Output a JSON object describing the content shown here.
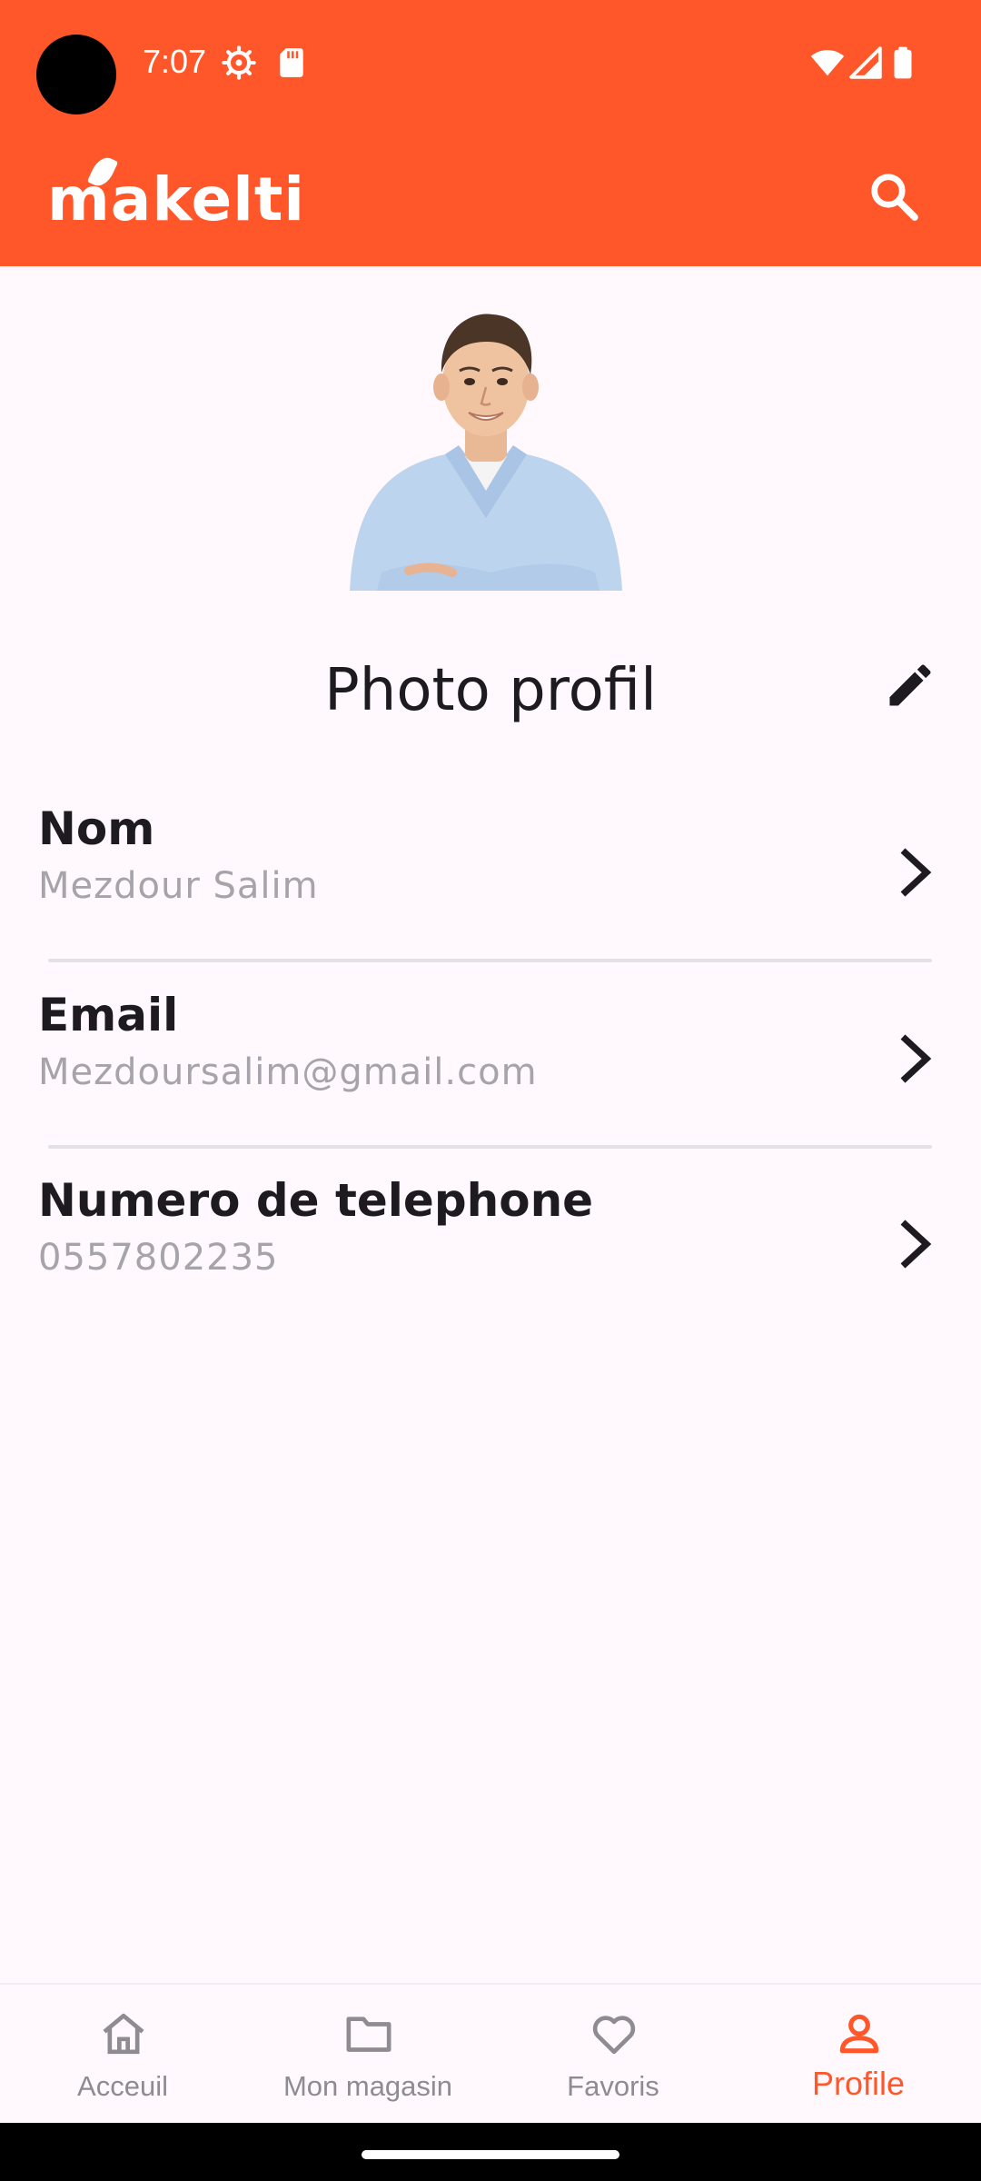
{
  "status_bar": {
    "time": "7:07"
  },
  "app_bar": {
    "logo_text": "akelti",
    "logo_first_letter": "m",
    "brand_color": "#FF572A"
  },
  "profile": {
    "photo_title": "Photo profil",
    "fields": [
      {
        "label": "Nom",
        "value": "Mezdour Salim"
      },
      {
        "label": "Email",
        "value": "Mezdoursalim@gmail.com"
      },
      {
        "label": "Numero de telephone",
        "value": "0557802235"
      }
    ]
  },
  "bottom_nav": {
    "items": [
      {
        "label": "Acceuil",
        "icon": "home-icon",
        "active": false
      },
      {
        "label": "Mon magasin",
        "icon": "folder-icon",
        "active": false
      },
      {
        "label": "Favoris",
        "icon": "heart-icon",
        "active": false
      },
      {
        "label": "Profile",
        "icon": "person-icon",
        "active": true
      }
    ],
    "active_color": "#FF572A",
    "inactive_color": "#8E8B93"
  }
}
